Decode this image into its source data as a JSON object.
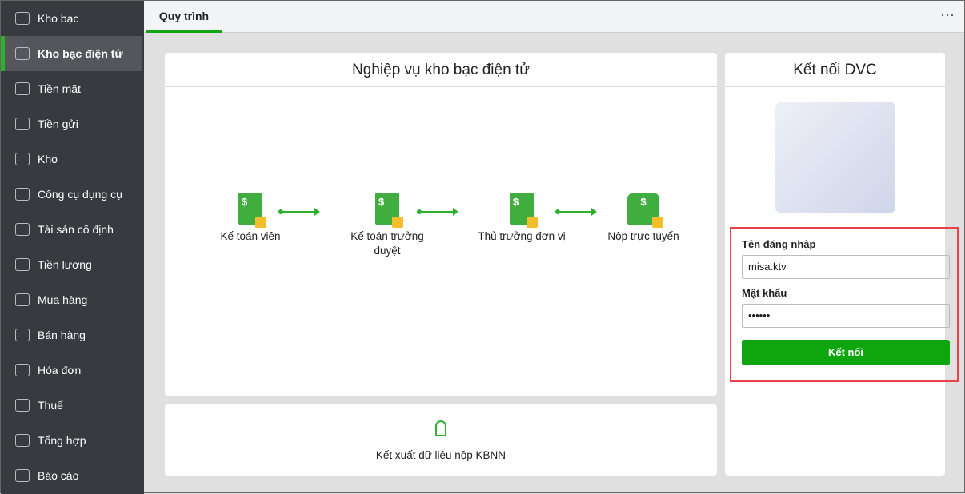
{
  "sidebar": {
    "items": [
      {
        "label": "Kho bạc",
        "icon": "bank-icon"
      },
      {
        "label": "Kho bạc điện tử",
        "icon": "monitor-dollar-icon"
      },
      {
        "label": "Tiền mặt",
        "icon": "cash-icon"
      },
      {
        "label": "Tiền gửi",
        "icon": "deposit-icon"
      },
      {
        "label": "Kho",
        "icon": "warehouse-icon"
      },
      {
        "label": "Công cụ dụng cụ",
        "icon": "tools-icon"
      },
      {
        "label": "Tài sản cố định",
        "icon": "car-icon"
      },
      {
        "label": "Tiền lương",
        "icon": "salary-icon"
      },
      {
        "label": "Mua hàng",
        "icon": "bag-icon"
      },
      {
        "label": "Bán hàng",
        "icon": "cart-icon"
      },
      {
        "label": "Hóa đơn",
        "icon": "invoice-icon"
      },
      {
        "label": "Thuế",
        "icon": "tax-icon"
      },
      {
        "label": "Tổng hợp",
        "icon": "summary-icon"
      },
      {
        "label": "Báo cáo",
        "icon": "report-icon"
      }
    ]
  },
  "tab": "Quy trình",
  "process": {
    "title": "Nghiệp vụ kho bạc điện tử",
    "steps": [
      "Kế toán viên",
      "Kế toán trưởng duyệt",
      "Thủ trưởng đơn vị",
      "Nộp trực tuyến"
    ]
  },
  "export": {
    "label": "Kết xuất dữ liệu nộp KBNN"
  },
  "connect": {
    "title": "Kết nối DVC",
    "username_label": "Tên đăng nhập",
    "username": "misa.ktv",
    "password_label": "Mật khẩu",
    "password": "••••••",
    "button": "Kết nối"
  }
}
